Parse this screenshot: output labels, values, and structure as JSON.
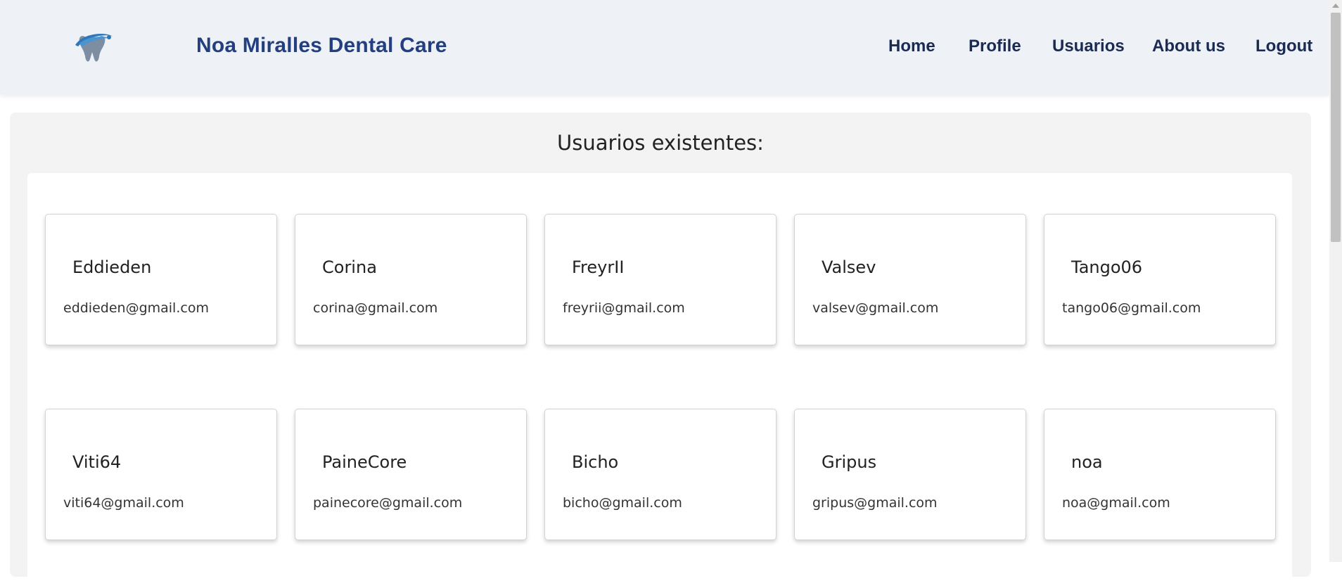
{
  "header": {
    "brand": "Noa Miralles Dental Care",
    "logo_icon": "tooth-logo-icon",
    "nav": [
      {
        "label": "Home"
      },
      {
        "label": "Profile"
      },
      {
        "label": "Usuarios"
      },
      {
        "label": "About us"
      },
      {
        "label": "Logout"
      }
    ]
  },
  "main": {
    "title": "Usuarios existentes:",
    "users": [
      {
        "name": "Eddieden",
        "email": "eddieden@gmail.com"
      },
      {
        "name": "Corina",
        "email": "corina@gmail.com"
      },
      {
        "name": "FreyrII",
        "email": "freyrii@gmail.com"
      },
      {
        "name": "Valsev",
        "email": "valsev@gmail.com"
      },
      {
        "name": "Tango06",
        "email": "tango06@gmail.com"
      },
      {
        "name": "Viti64",
        "email": "viti64@gmail.com"
      },
      {
        "name": "PaineCore",
        "email": "painecore@gmail.com"
      },
      {
        "name": "Bicho",
        "email": "bicho@gmail.com"
      },
      {
        "name": "Gripus",
        "email": "gripus@gmail.com"
      },
      {
        "name": "noa",
        "email": "noa@gmail.com"
      }
    ]
  },
  "colors": {
    "header_bg": "#eef2f6",
    "brand": "#233f80",
    "nav": "#1b2a52",
    "panel_bg": "#f3f3f3"
  }
}
